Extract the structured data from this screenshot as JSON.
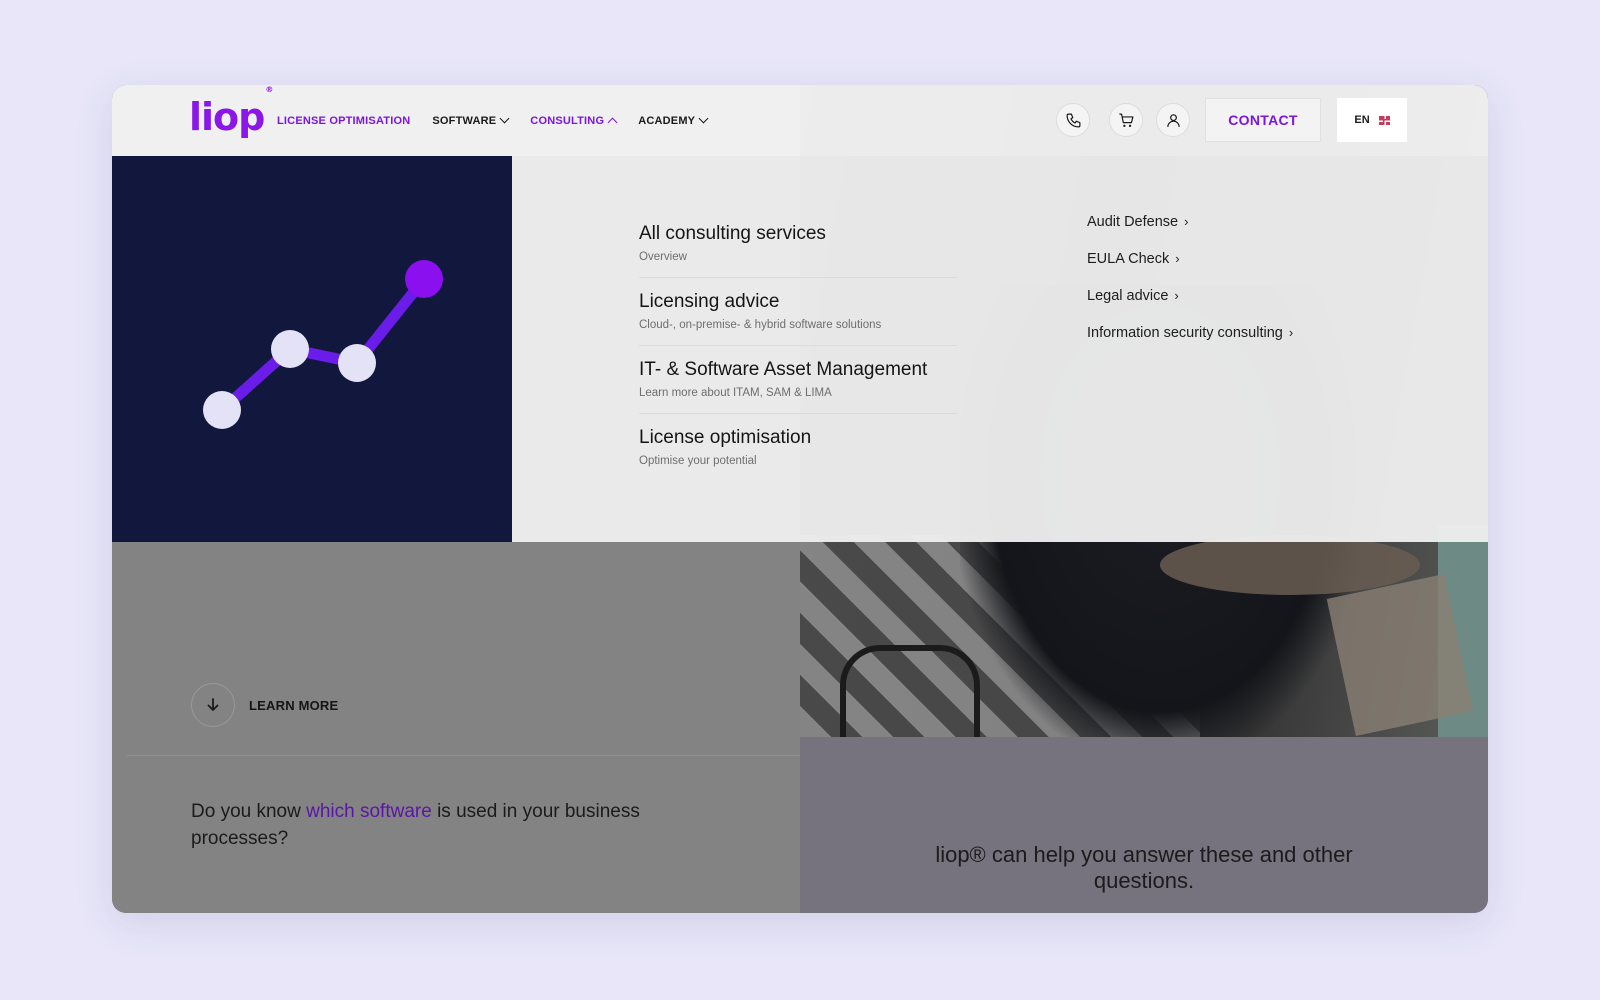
{
  "header": {
    "logo": "liop",
    "logo_mark": "®",
    "nav": [
      {
        "label": "LICENSE OPTIMISATION",
        "active": true,
        "dropdown": false
      },
      {
        "label": "SOFTWARE",
        "active": false,
        "dropdown": true
      },
      {
        "label": "CONSULTING",
        "active": true,
        "dropdown": true,
        "expanded": true
      },
      {
        "label": "ACADEMY",
        "active": false,
        "dropdown": true
      }
    ],
    "icons": [
      "phone-icon",
      "cart-icon",
      "user-icon"
    ],
    "contact_label": "CONTACT",
    "language": "EN"
  },
  "mega_menu": {
    "items": [
      {
        "title": "All consulting services",
        "subtitle": "Overview"
      },
      {
        "title": "Licensing advice",
        "subtitle": "Cloud-, on-premise- & hybrid software solutions"
      },
      {
        "title": "IT- & Software Asset Management",
        "subtitle": "Learn more about ITAM, SAM & LIMA"
      },
      {
        "title": "License optimisation",
        "subtitle": "Optimise your potential"
      }
    ],
    "side_links": [
      {
        "label": "Audit Defense",
        "arrow": "›"
      },
      {
        "label": "EULA Check",
        "arrow": "›"
      },
      {
        "label": "Legal advice",
        "arrow": "›"
      },
      {
        "label": "Information security consulting",
        "arrow": "›"
      }
    ]
  },
  "page": {
    "learn_more": "LEARN MORE",
    "question_left": {
      "before": "Do you know ",
      "highlight": "which software",
      "after": " is used in your business processes?"
    },
    "question_right": "liop® can help you answer these and other questions."
  },
  "colors": {
    "brand": "#7a16e0",
    "menu_visual_bg": "#12173e",
    "accent_dot": "#8a10f0",
    "line": "#6a1ce8",
    "light_dot": "#e4e2f6"
  }
}
